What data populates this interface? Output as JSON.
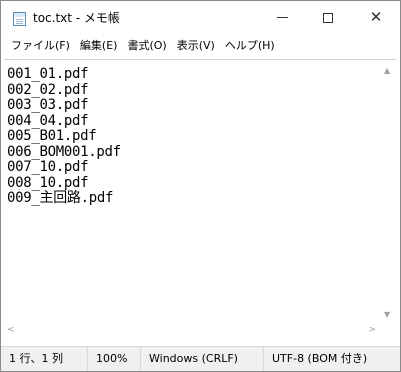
{
  "window": {
    "title": "toc.txt - メモ帳",
    "close_symbol": "✕",
    "icon": "notepad-icon"
  },
  "menu": [
    {
      "label": "ファイル(F)"
    },
    {
      "label": "編集(E)"
    },
    {
      "label": "書式(O)"
    },
    {
      "label": "表示(V)"
    },
    {
      "label": "ヘルプ(H)"
    }
  ],
  "editor": {
    "lines": [
      "001_01.pdf",
      "002_02.pdf",
      "003_03.pdf",
      "004_04.pdf",
      "005_B01.pdf",
      "006_BOM001.pdf",
      "007_10.pdf",
      "008_10.pdf",
      "009_主回路.pdf"
    ]
  },
  "scroll": {
    "up": "▲",
    "down": "▼",
    "left": "<",
    "right": ">"
  },
  "status": {
    "position": "1 行、1 列",
    "zoom": "100%",
    "line_ending": "Windows (CRLF)",
    "encoding": "UTF-8 (BOM 付き)"
  }
}
